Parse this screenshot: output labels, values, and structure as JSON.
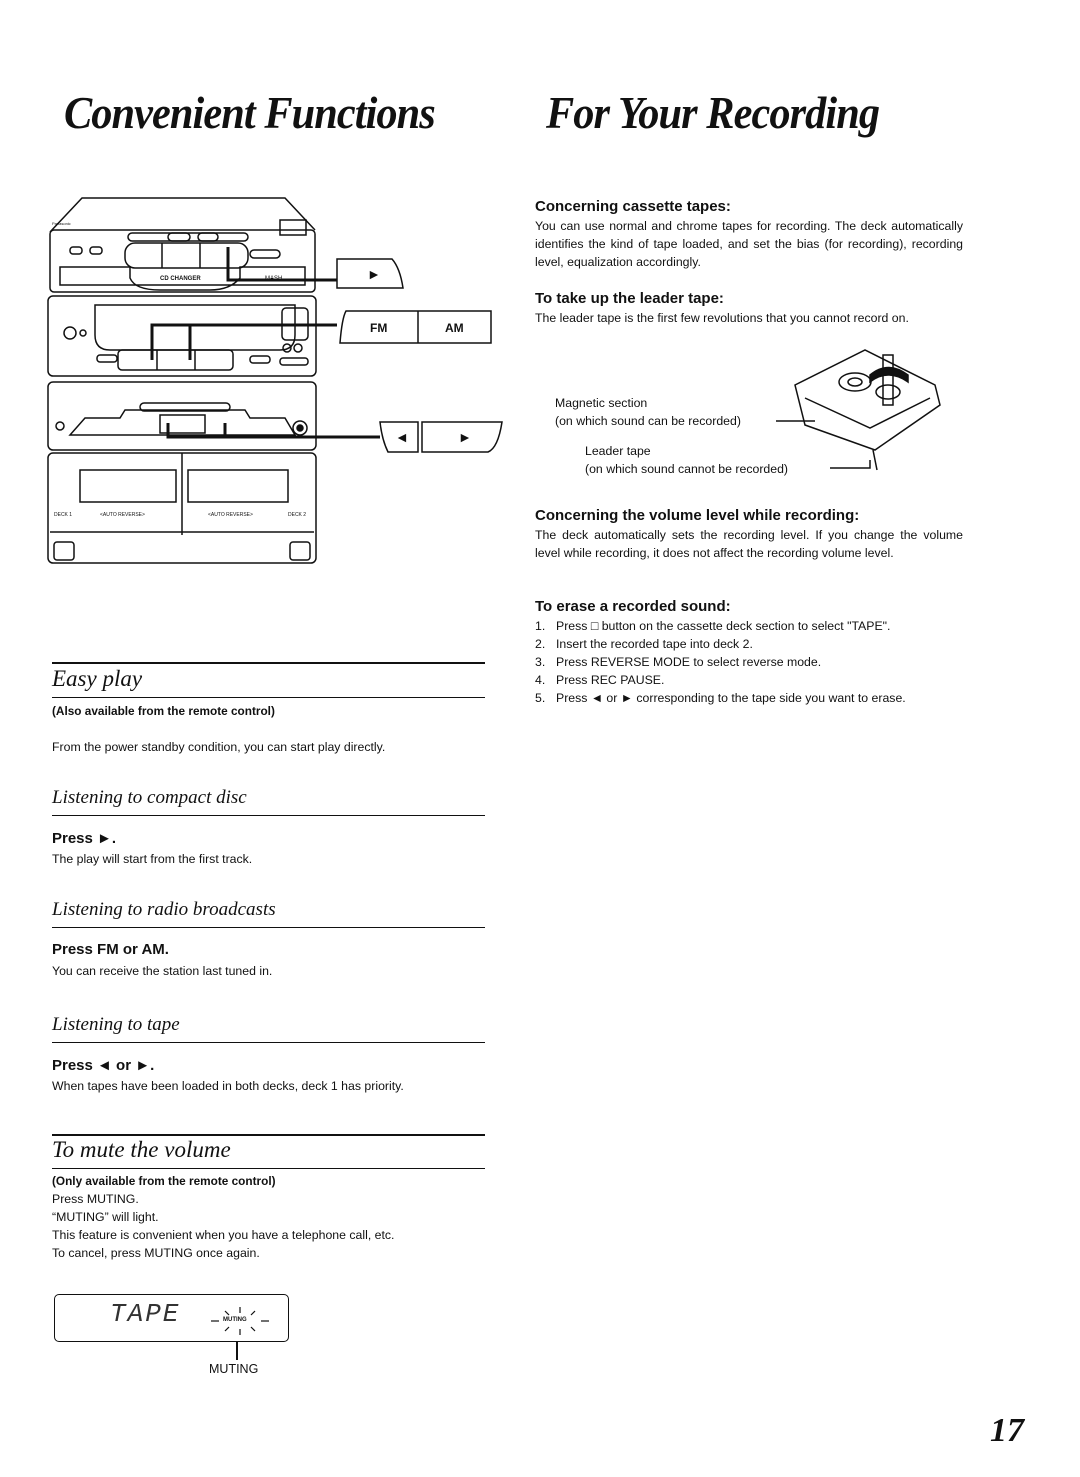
{
  "header": {
    "title_left": "Convenient Functions",
    "title_right": "For Your Recording"
  },
  "illustration": {
    "unit_labels": {
      "cd_changer": "CD CHANGER",
      "brand": "Panasonic",
      "mash": "MASH",
      "deck1": "DECK 1",
      "deck2": "DECK 2",
      "auto_reverse": "<AUTO REVERSE>"
    },
    "callout_buttons": {
      "cd_play": "►",
      "fm": "FM",
      "am": "AM",
      "tape_reverse": "◄",
      "tape_forward": "►"
    }
  },
  "recording": {
    "sections": [
      {
        "heading": "Concerning cassette tapes:",
        "body": "You can use normal and chrome tapes for recording. The deck automatically identifies the kind of tape loaded, and set the bias (for recording), recording level, equalization accordingly."
      },
      {
        "heading": "To take up the leader tape:",
        "body": "The leader tape is the first few revolutions that you cannot record on."
      }
    ],
    "diagram": {
      "label1_line1": "Magnetic section",
      "label1_line2": "(on which sound can be recorded)",
      "label2_line1": "Leader tape",
      "label2_line2": "(on which sound cannot be recorded)"
    },
    "volume": {
      "heading": "Concerning the volume level while recording:",
      "body": "The deck automatically sets the recording level. If you change the volume level while recording, it does not affect the recording volume level."
    },
    "erase": {
      "heading": "To erase a recorded sound:",
      "steps": [
        {
          "n": "1.",
          "text": "Press □ button on the cassette deck section to select \"TAPE\"."
        },
        {
          "n": "2.",
          "text": "Insert the recorded tape into deck 2."
        },
        {
          "n": "3.",
          "text": "Press REVERSE MODE to select reverse mode."
        },
        {
          "n": "4.",
          "text": "Press REC PAUSE."
        },
        {
          "n": "5.",
          "text": "Press ◄ or ► corresponding to the tape side you want to erase."
        }
      ]
    }
  },
  "easy_play": {
    "title": "Easy play",
    "note": "(Also available from the remote control)",
    "intro": "From the power standby condition, you can start play directly.",
    "subsections": [
      {
        "title": "Listening to compact disc",
        "press": "Press ►.",
        "desc": "The play will start from the first track."
      },
      {
        "title": "Listening to radio broadcasts",
        "press": "Press FM or AM.",
        "desc": "You can receive the station last tuned in."
      },
      {
        "title": "Listening to tape",
        "press": "Press ◄ or ►.",
        "desc": "When tapes have been loaded in both decks, deck 1 has priority."
      }
    ]
  },
  "mute": {
    "title": "To mute the volume",
    "note": "(Only available from the remote control)",
    "lines": [
      "Press MUTING.",
      "“MUTING” will light.",
      "This feature is convenient when you have a telephone call, etc.",
      "To cancel, press MUTING once again."
    ],
    "display_text": "TAPE",
    "display_indicator": "MUTING",
    "callout_label": "MUTING"
  },
  "page_number": "17"
}
